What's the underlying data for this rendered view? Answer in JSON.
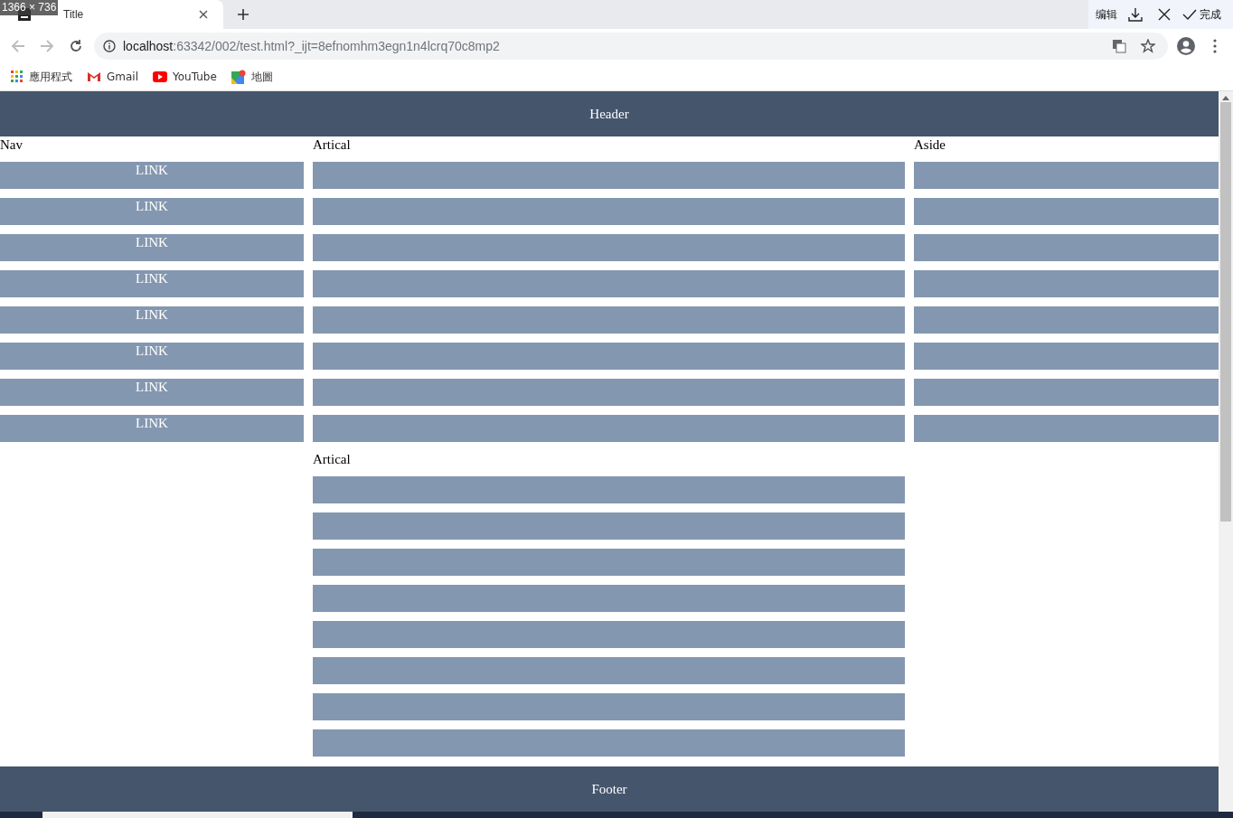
{
  "overlay_label": "1366 × 736",
  "browser": {
    "tab": {
      "title": "Title"
    },
    "url": {
      "host": "localhost",
      "rest": ":63342/002/test.html?_ijt=8efnomhm3egn1n4lcrq70c8mp2"
    },
    "capture_toolbar": {
      "edit": "编辑",
      "done": "完成"
    },
    "bookmarks": [
      {
        "kind": "apps",
        "label": "應用程式"
      },
      {
        "kind": "gmail",
        "label": "Gmail"
      },
      {
        "kind": "youtube",
        "label": "YouTube"
      },
      {
        "kind": "maps",
        "label": "地圖"
      }
    ]
  },
  "page": {
    "header": "Header",
    "nav": {
      "title": "Nav",
      "links": [
        "LINK",
        "LINK",
        "LINK",
        "LINK",
        "LINK",
        "LINK",
        "LINK",
        "LINK"
      ]
    },
    "articles": [
      {
        "title": "Artical",
        "bars": [
          {
            "kind": "bar"
          },
          {
            "kind": "bar"
          },
          {
            "kind": "bar"
          },
          {
            "kind": "bar"
          },
          {
            "kind": "bar"
          },
          {
            "kind": "bar"
          },
          {
            "kind": "bar"
          },
          {
            "kind": "bar"
          }
        ]
      },
      {
        "title": "Artical",
        "bars": [
          {
            "kind": "bar"
          },
          {
            "kind": "bar"
          },
          {
            "kind": "bar"
          },
          {
            "kind": "bar"
          },
          {
            "kind": "bar"
          },
          {
            "kind": "bar"
          },
          {
            "kind": "bar"
          },
          {
            "kind": "bar"
          }
        ]
      }
    ],
    "aside": {
      "title": "Aside",
      "bars": [
        {
          "kind": "bar"
        },
        {
          "kind": "bar"
        },
        {
          "kind": "bar"
        },
        {
          "kind": "bar"
        },
        {
          "kind": "bar"
        },
        {
          "kind": "bar"
        },
        {
          "kind": "bar"
        },
        {
          "kind": "bar"
        }
      ]
    },
    "footer": "Footer"
  }
}
